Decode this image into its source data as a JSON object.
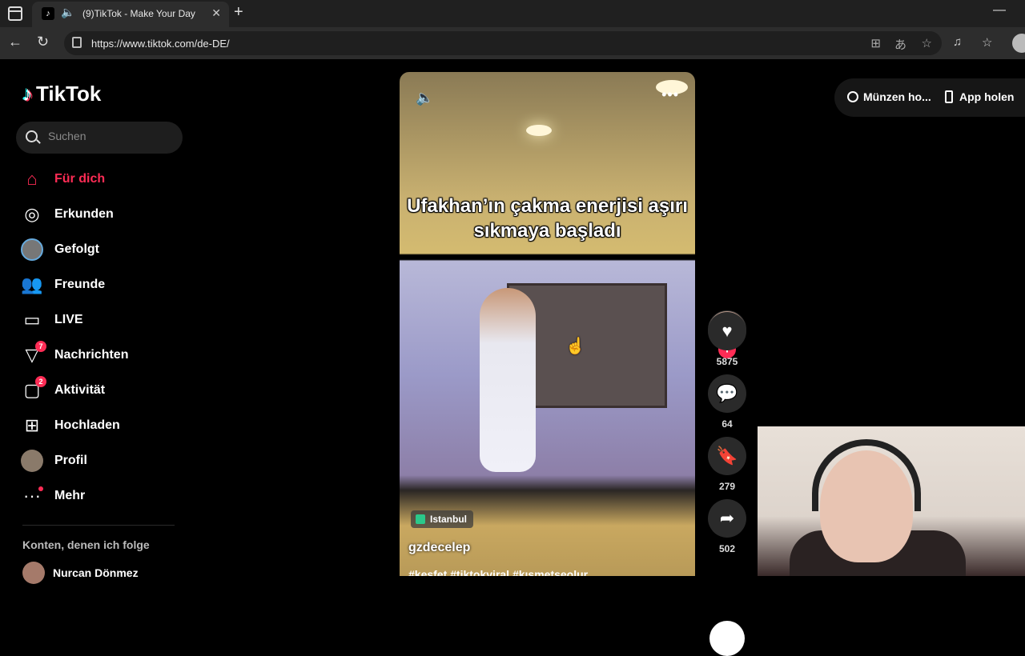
{
  "browser": {
    "tab_title": "(9)TikTok - Make Your Day",
    "url": "https://www.tiktok.com/de-DE/"
  },
  "sidebar": {
    "logo_text": "TikTok",
    "search_placeholder": "Suchen",
    "items": [
      {
        "label": "Für dich",
        "icon": "home-icon",
        "active": true
      },
      {
        "label": "Erkunden",
        "icon": "compass-icon"
      },
      {
        "label": "Gefolgt",
        "icon": "avatar-icon"
      },
      {
        "label": "Freunde",
        "icon": "friends-icon"
      },
      {
        "label": "LIVE",
        "icon": "live-icon"
      },
      {
        "label": "Nachrichten",
        "icon": "messages-icon",
        "badge": "7"
      },
      {
        "label": "Aktivität",
        "icon": "activity-icon",
        "badge": "2"
      },
      {
        "label": "Hochladen",
        "icon": "upload-icon"
      },
      {
        "label": "Profil",
        "icon": "profile-icon"
      },
      {
        "label": "Mehr",
        "icon": "more-icon"
      }
    ],
    "following_section_label": "Konten, denen ich folge",
    "following_first": "Nurcan Dönmez"
  },
  "video": {
    "caption": "Ufakhan’ın çakma enerjisi aşırı sıkmaya başladı",
    "location": "Istanbul",
    "author": "gzdecelep",
    "hashtags": "#keşfet #tiktokviral #kısmetseolur"
  },
  "actions": {
    "likes": "5875",
    "comments": "64",
    "saves": "279",
    "shares": "502"
  },
  "top_right": {
    "coins_label": "Münzen ho...",
    "app_label": "App holen"
  },
  "colors": {
    "accent": "#fe2c55"
  }
}
